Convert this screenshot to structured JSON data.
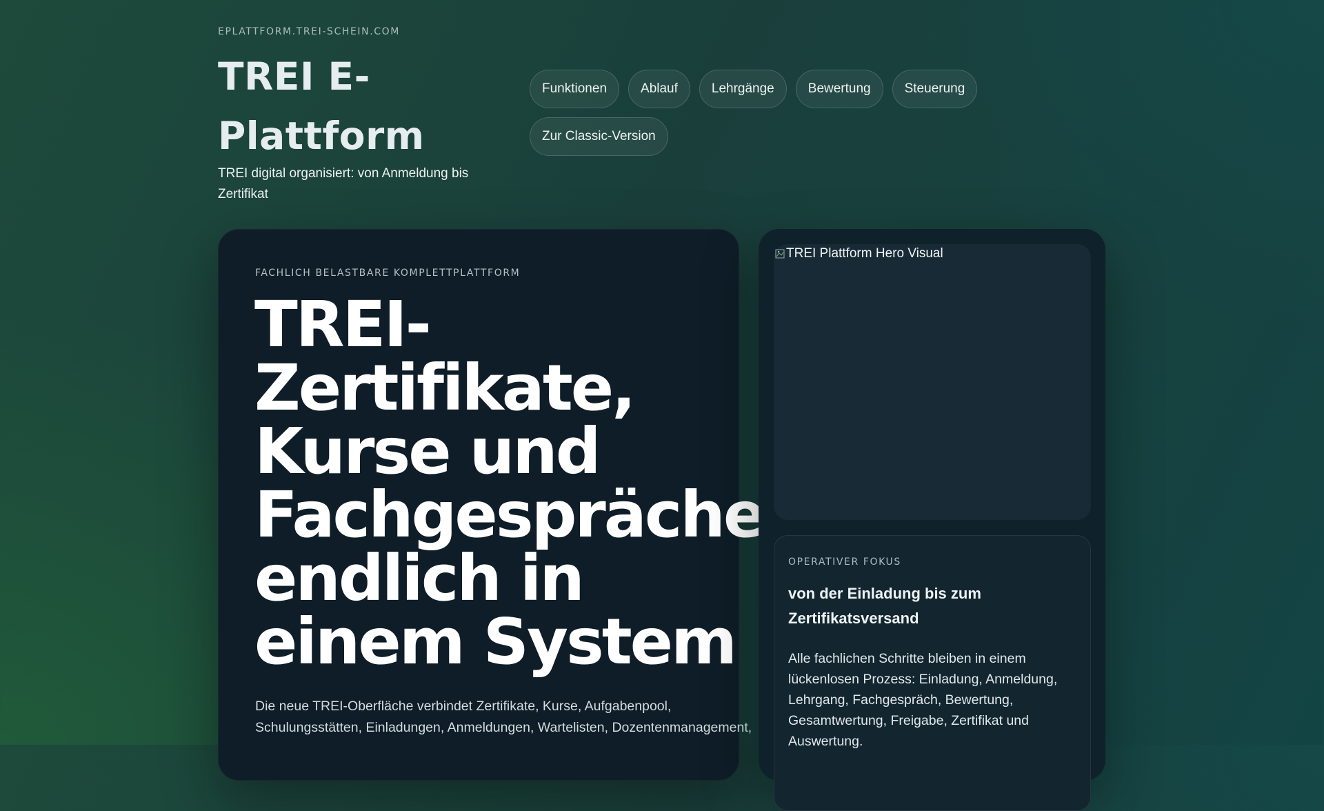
{
  "header": {
    "site_url": "EPLATTFORM.TREI-SCHEIN.COM",
    "brand_title": "TREI E-Plattform",
    "tagline": "TREI digital organisiert: von Anmeldung bis Zertifikat"
  },
  "nav": {
    "items": [
      {
        "label": "Funktionen"
      },
      {
        "label": "Ablauf"
      },
      {
        "label": "Lehrgänge"
      },
      {
        "label": "Bewertung"
      },
      {
        "label": "Steuerung"
      },
      {
        "label": "Zur Classic-Version"
      }
    ]
  },
  "hero": {
    "eyebrow": "FACHLICH BELASTBARE KOMPLETTPLATTFORM",
    "headline": "TREI-\nZertifikate,\nKurse und\nFachgespräche\nendlich in\neinem System",
    "body": "Die neue TREI-Oberfläche verbindet Zertifikate, Kurse, Aufgabenpool, Schulungsstätten, Einladungen, Anmeldungen, Wartelisten, Dozentenmanagement,"
  },
  "side": {
    "visual_alt": "TREI Plattform Hero Visual",
    "focus_eyebrow": "OPERATIVER FOKUS",
    "focus_title": "von der Einladung bis zum Zertifikatsversand",
    "focus_body": "Alle fachlichen Schritte bleiben in einem lückenlosen Prozess: Einladung, Anmeldung, Lehrgang, Fachgespräch, Bewertung, Gesamtwertung, Freigabe, Zertifikat und Auswertung."
  },
  "colors": {
    "background": "#1a3f3b",
    "card": "#0e1d27",
    "text": "#ffffff"
  }
}
